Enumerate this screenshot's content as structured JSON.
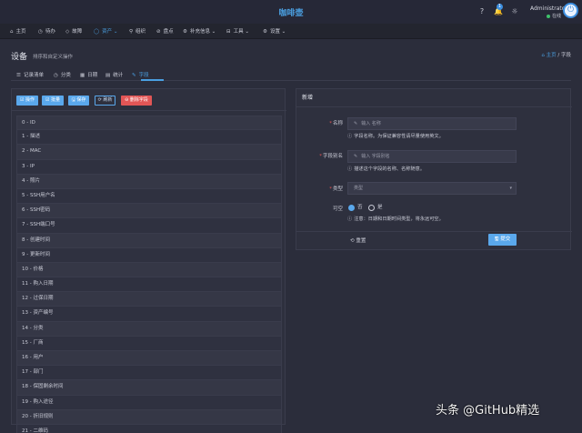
{
  "header": {
    "brand": "咖啡壶",
    "notification_count": "1",
    "user_name": "Administrator",
    "user_status": "在线"
  },
  "nav": [
    {
      "label": "主页",
      "icon": "home-icon"
    },
    {
      "label": "待办",
      "icon": "clock-icon"
    },
    {
      "label": "故障",
      "icon": "shield-icon"
    },
    {
      "label": "资产 ⌄",
      "icon": "circle-icon"
    },
    {
      "label": "组织",
      "icon": "user-icon"
    },
    {
      "label": "盘点",
      "icon": "check-icon"
    },
    {
      "label": "补充信息 ⌄",
      "icon": "gear-icon"
    },
    {
      "label": "工具 ⌄",
      "icon": "suitcase-icon"
    },
    {
      "label": "设置 ⌄",
      "icon": "settings-icon"
    }
  ],
  "page": {
    "title": "设备",
    "subtitle": "排序和自定义操作",
    "breadcrumb_home": "主页",
    "breadcrumb_sep": "/",
    "breadcrumb_current": "字段"
  },
  "tabs": [
    {
      "label": "记录清单",
      "icon": "list-icon"
    },
    {
      "label": "分类",
      "icon": "tag-icon"
    },
    {
      "label": "日期",
      "icon": "calendar-icon"
    },
    {
      "label": "统计",
      "icon": "chart-icon"
    },
    {
      "label": "字段",
      "icon": "pencil-icon"
    }
  ],
  "toolbar": {
    "operate": "☑ 操作",
    "batch": "☑ 批量",
    "save": "🖫 保存",
    "refresh": "⟳ 刷新",
    "delete": "⊖ 删除字段"
  },
  "fields": [
    "0 - ID",
    "1 - 描述",
    "2 - MAC",
    "3 - IP",
    "4 - 照片",
    "5 - SSH用户名",
    "6 - SSH密码",
    "7 - SSH端口号",
    "8 - 创建时间",
    "9 - 更新时间",
    "10 - 价格",
    "11 - 购入日期",
    "12 - 过保日期",
    "13 - 资产编号",
    "14 - 分类",
    "15 - 厂商",
    "16 - 用户",
    "17 - 部门",
    "18 - 保固剩余时间",
    "19 - 购入途径",
    "20 - 折旧规则",
    "21 - 二维码"
  ],
  "form": {
    "header": "新增",
    "name_label": "名称",
    "name_placeholder": "输入 名称",
    "name_help": "字段名称。为保证兼容性请尽量使用英文。",
    "alias_label": "字段别名",
    "alias_placeholder": "输入 字段别名",
    "alias_help": "描述这个字段的名称、名称随意。",
    "type_label": "类型",
    "type_value": "类型",
    "nullable_label": "可空",
    "nullable_no": "否",
    "nullable_yes": "是",
    "nullable_help": "注意：日期和日期时间类型，将永远可空。",
    "reset": "⟲ 重置",
    "submit": "🖫 提交"
  },
  "watermark": "头条 @GitHub精选"
}
